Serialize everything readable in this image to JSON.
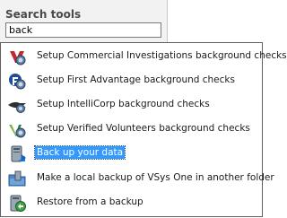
{
  "header": {
    "title": "Search tools",
    "search_value": "back"
  },
  "results": [
    {
      "label": "Setup Commercial Investigations background checks",
      "icon": "commercial-investigations-icon",
      "selected": false
    },
    {
      "label": "Setup First Advantage background checks",
      "icon": "first-advantage-icon",
      "selected": false
    },
    {
      "label": "Setup IntelliCorp background checks",
      "icon": "intellicorp-icon",
      "selected": false
    },
    {
      "label": "Setup Verified Volunteers background checks",
      "icon": "verified-volunteers-icon",
      "selected": false
    },
    {
      "label": "Back up your data",
      "icon": "backup-icon",
      "selected": true
    },
    {
      "label": "Make a local backup of VSys One in another folder",
      "icon": "local-backup-icon",
      "selected": false
    },
    {
      "label": "Restore from a backup",
      "icon": "restore-icon",
      "selected": false
    }
  ],
  "colors": {
    "selection": "#3399ff",
    "title_text": "#4a4a4a",
    "border": "#5f5f5f"
  }
}
